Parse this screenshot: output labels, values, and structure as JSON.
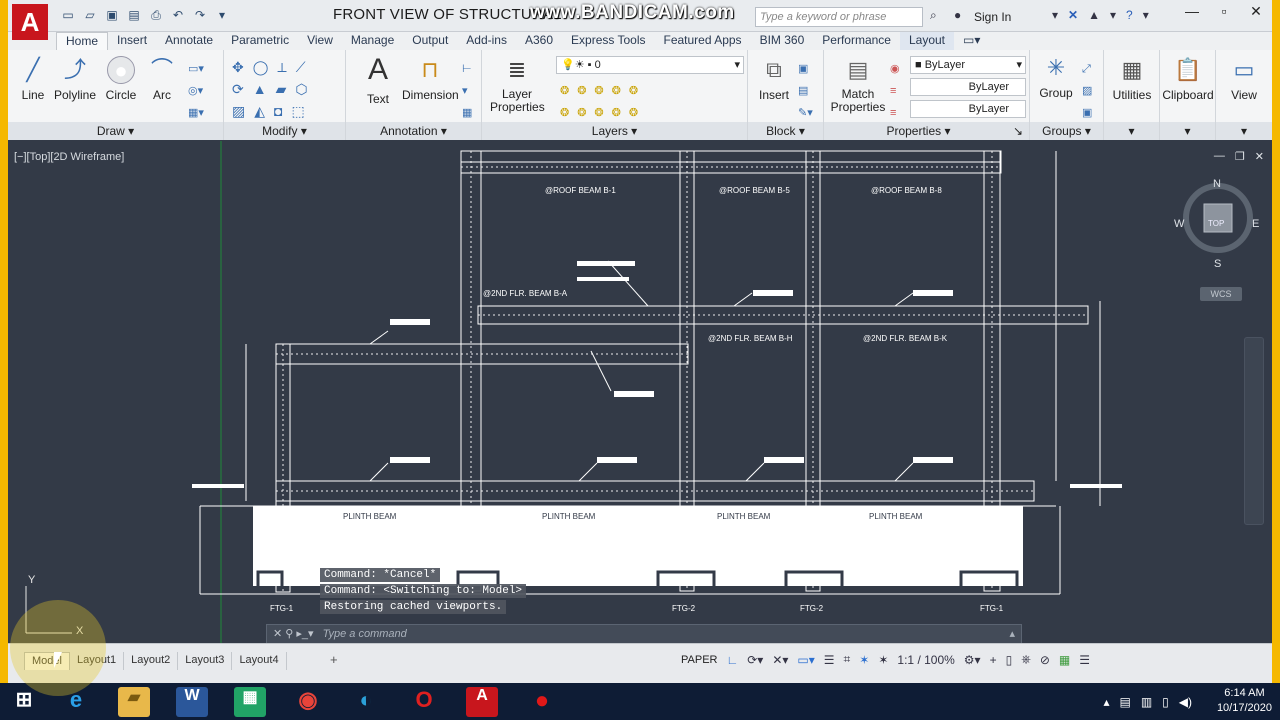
{
  "window": {
    "title": "FRONT VIEW OF STRUCTURAL",
    "watermark": "www.BANDICAM.com",
    "search_placeholder": "Type a keyword or phrase",
    "signin": "Sign In"
  },
  "app_logo": "A",
  "tabs": [
    "Home",
    "Insert",
    "Annotate",
    "Parametric",
    "View",
    "Manage",
    "Output",
    "Add-ins",
    "A360",
    "Express Tools",
    "Featured Apps",
    "BIM 360",
    "Performance",
    "Layout"
  ],
  "active_tab": "Home",
  "ribbon": {
    "draw": {
      "title": "Draw",
      "line": "Line",
      "polyline": "Polyline",
      "circle": "Circle",
      "arc": "Arc"
    },
    "modify": {
      "title": "Modify"
    },
    "annotation": {
      "title": "Annotation",
      "text": "Text",
      "dimension": "Dimension"
    },
    "layers": {
      "title": "Layers",
      "layer_properties": "Layer\nProperties",
      "current_layer": "0"
    },
    "block": {
      "title": "Block",
      "insert": "Insert"
    },
    "properties": {
      "title": "Properties",
      "match": "Match\nProperties",
      "color": "ByLayer",
      "linetype": "ByLayer",
      "lineweight": "ByLayer"
    },
    "groups": {
      "title": "Groups",
      "group": "Group"
    },
    "utilities": "Utilities",
    "clipboard": "Clipboard",
    "view": "View"
  },
  "viewport": {
    "label": "[−][Top][2D Wireframe]",
    "compass": {
      "n": "N",
      "s": "S",
      "e": "E",
      "w": "W",
      "top": "TOP",
      "wcs": "WCS"
    }
  },
  "drawing": {
    "beam_labels": [
      "@ROOF BEAM B-1",
      "@ROOF BEAM B-5",
      "@ROOF BEAM B-8",
      "@2ND FLR. BEAM B-A",
      "@2ND FLR. BEAM B-H",
      "@2ND FLR. BEAM B-K"
    ],
    "plinth_labels": [
      "PLINTH BEAM",
      "PLINTH BEAM",
      "PLINTH BEAM",
      "PLINTH BEAM"
    ],
    "footing_labels": [
      "FTG-1",
      "FTG-2",
      "FTG-2",
      "FTG-1"
    ]
  },
  "command": {
    "log": [
      "Command: *Cancel*",
      "Command:   <Switching to: Model>",
      "Restoring cached viewports."
    ],
    "placeholder": "Type a command"
  },
  "layout_tabs": [
    "Model",
    "Layout1",
    "Layout2",
    "Layout3",
    "Layout4"
  ],
  "active_layout": "Model",
  "status": {
    "space": "PAPER",
    "scale": "1:1 / 100%"
  },
  "taskbar": {
    "time": "6:14 AM",
    "date": "10/17/2020"
  },
  "colors": {
    "canvas": "#333a47",
    "accent": "#c8161d",
    "taskbar": "#0e1c35",
    "frame": "#f5b800"
  }
}
